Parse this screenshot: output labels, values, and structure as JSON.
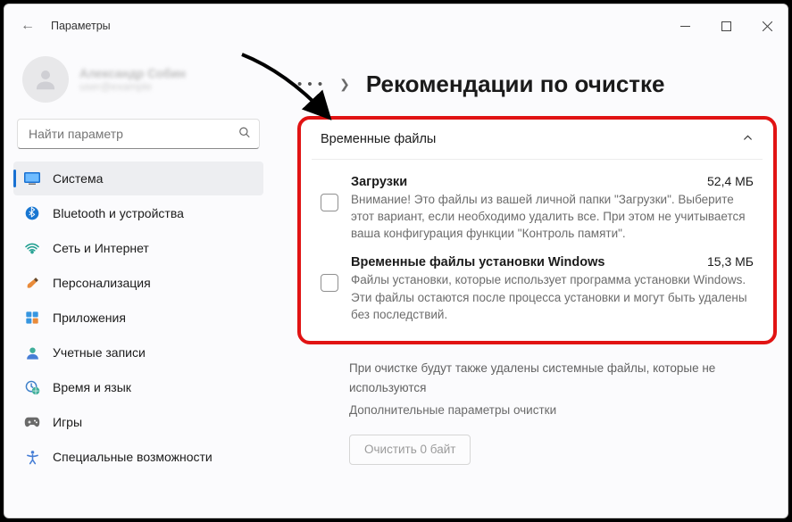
{
  "window": {
    "title": "Параметры"
  },
  "account": {
    "name": "Александр Собин",
    "sub": "user@example"
  },
  "search": {
    "placeholder": "Найти параметр"
  },
  "sidebar": {
    "items": [
      {
        "label": "Система"
      },
      {
        "label": "Bluetooth и устройства"
      },
      {
        "label": "Сеть и Интернет"
      },
      {
        "label": "Персонализация"
      },
      {
        "label": "Приложения"
      },
      {
        "label": "Учетные записи"
      },
      {
        "label": "Время и язык"
      },
      {
        "label": "Игры"
      },
      {
        "label": "Специальные возможности"
      }
    ]
  },
  "icons": {
    "system": "🖥️",
    "bluetooth": "",
    "network": "",
    "personalization": "",
    "apps": "",
    "accounts": "",
    "time": "",
    "gaming": "",
    "accessibility": ""
  },
  "page": {
    "title": "Рекомендации по очистке"
  },
  "section": {
    "title": "Временные файлы"
  },
  "items": [
    {
      "title": "Загрузки",
      "size": "52,4 МБ",
      "desc": "Внимание! Это файлы из вашей личной папки \"Загрузки\". Выберите этот вариант, если необходимо удалить все. При этом не учитывается ваша конфигурация функции \"Контроль памяти\"."
    },
    {
      "title": "Временные файлы установки Windows",
      "size": "15,3 МБ",
      "desc": "Файлы установки, которые использует программа установки Windows.  Эти файлы остаются после процесса установки и могут быть удалены без последствий."
    }
  ],
  "below": {
    "note": "При очистке будут также удалены системные файлы, которые не используются",
    "link": "Дополнительные параметры очистки"
  },
  "clean_button": "Очистить 0 байт",
  "colors": {
    "accent": "#1971d2",
    "highlight": "#e11313"
  }
}
